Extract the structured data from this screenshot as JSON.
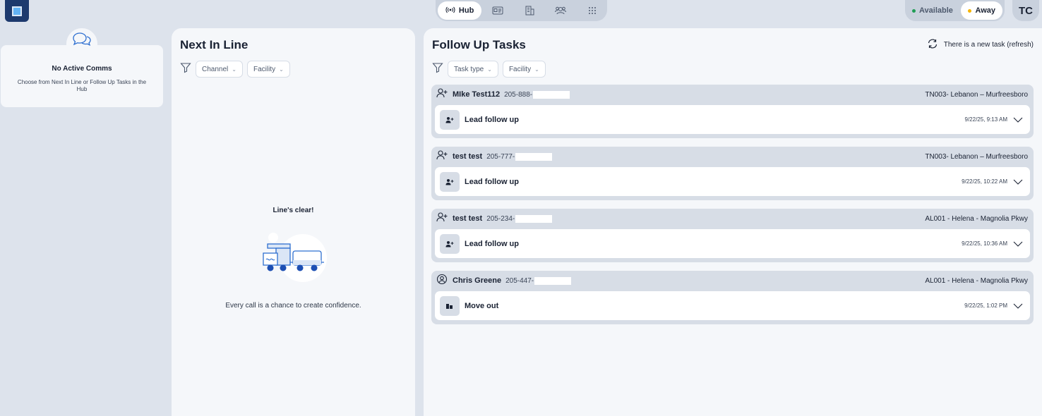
{
  "nav": {
    "hub_label": "Hub",
    "icons": [
      "id-card-icon",
      "building-icon",
      "people-icon",
      "grid-dots-icon"
    ]
  },
  "status": {
    "available_label": "Available",
    "away_label": "Away",
    "available_color": "#1f9d55",
    "away_color": "#f5b400"
  },
  "user": {
    "initials": "TC"
  },
  "comms": {
    "title": "No Active Comms",
    "subtitle": "Choose from Next In Line or Follow Up Tasks in the Hub"
  },
  "next_in_line": {
    "title": "Next In Line",
    "filters": [
      "Channel",
      "Facility"
    ],
    "empty_title": "Line's clear!",
    "empty_subtitle": "Every call is a chance to create confidence."
  },
  "follow_up": {
    "title": "Follow Up Tasks",
    "refresh_label": "There is a new task (refresh)",
    "filters": [
      "Task type",
      "Facility"
    ],
    "tasks": [
      {
        "name": "MIke Test112",
        "phone": "205-888-",
        "facility": "TN003- Lebanon – Murfreesboro",
        "type": "Lead follow up",
        "time": "9/22/25, 9:13 AM",
        "contact_icon": "person-add-icon",
        "type_icon": "person-add-icon"
      },
      {
        "name": "test test",
        "phone": "205-777-",
        "facility": "TN003- Lebanon – Murfreesboro",
        "type": "Lead follow up",
        "time": "9/22/25, 10:22 AM",
        "contact_icon": "person-add-icon",
        "type_icon": "person-add-icon"
      },
      {
        "name": "test test",
        "phone": "205-234-",
        "facility": "AL001 - Helena - Magnolia Pkwy",
        "type": "Lead follow up",
        "time": "9/22/25, 10:36 AM",
        "contact_icon": "person-add-icon",
        "type_icon": "person-add-icon"
      },
      {
        "name": "Chris Greene",
        "phone": "205-447-",
        "facility": "AL001 - Helena - Magnolia Pkwy",
        "type": "Move out",
        "time": "9/22/25, 1:02 PM",
        "contact_icon": "user-circle-icon",
        "type_icon": "move-out-icon"
      }
    ]
  }
}
